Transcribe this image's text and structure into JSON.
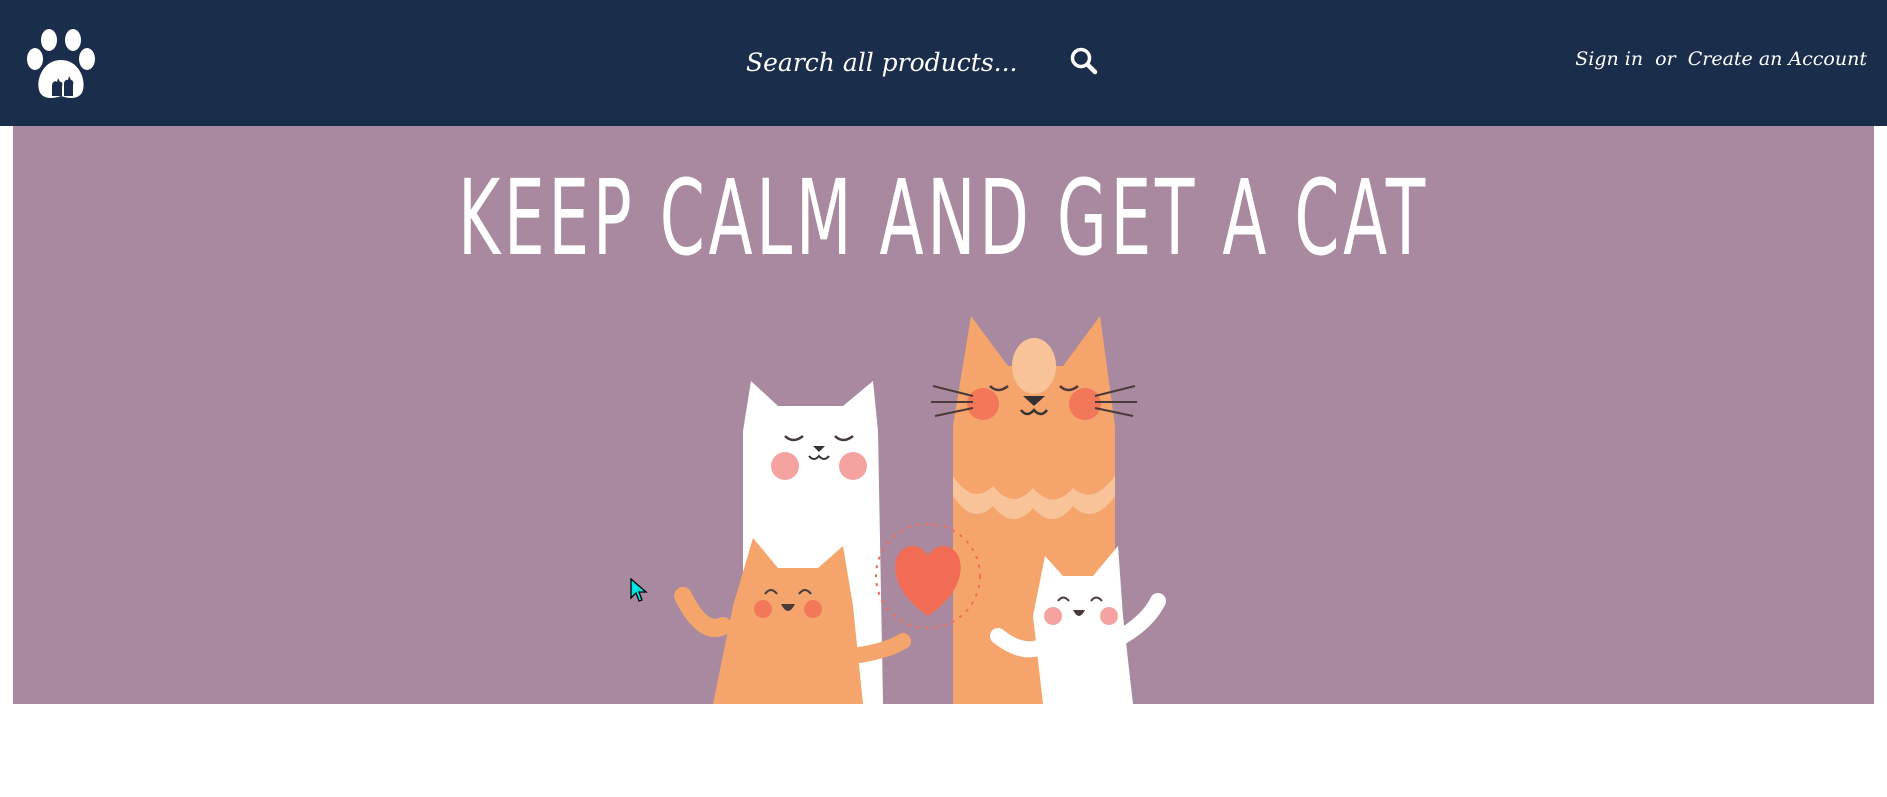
{
  "header": {
    "logo_icon": "paw-print-icon",
    "search": {
      "placeholder": "Search all products...",
      "value": "",
      "icon": "search-icon"
    },
    "account": {
      "sign_in_label": "Sign in",
      "separator": "or",
      "create_account_label": "Create an Account"
    }
  },
  "hero": {
    "title": "KEEP CALM AND GET A CAT",
    "image_icon": "cat-family-illustration",
    "background_color": "#a8899f"
  },
  "colors": {
    "header_bg": "#1a2d4a",
    "text": "#ffffff",
    "cat_orange": "#f5a56b",
    "heart": "#f26b55"
  }
}
